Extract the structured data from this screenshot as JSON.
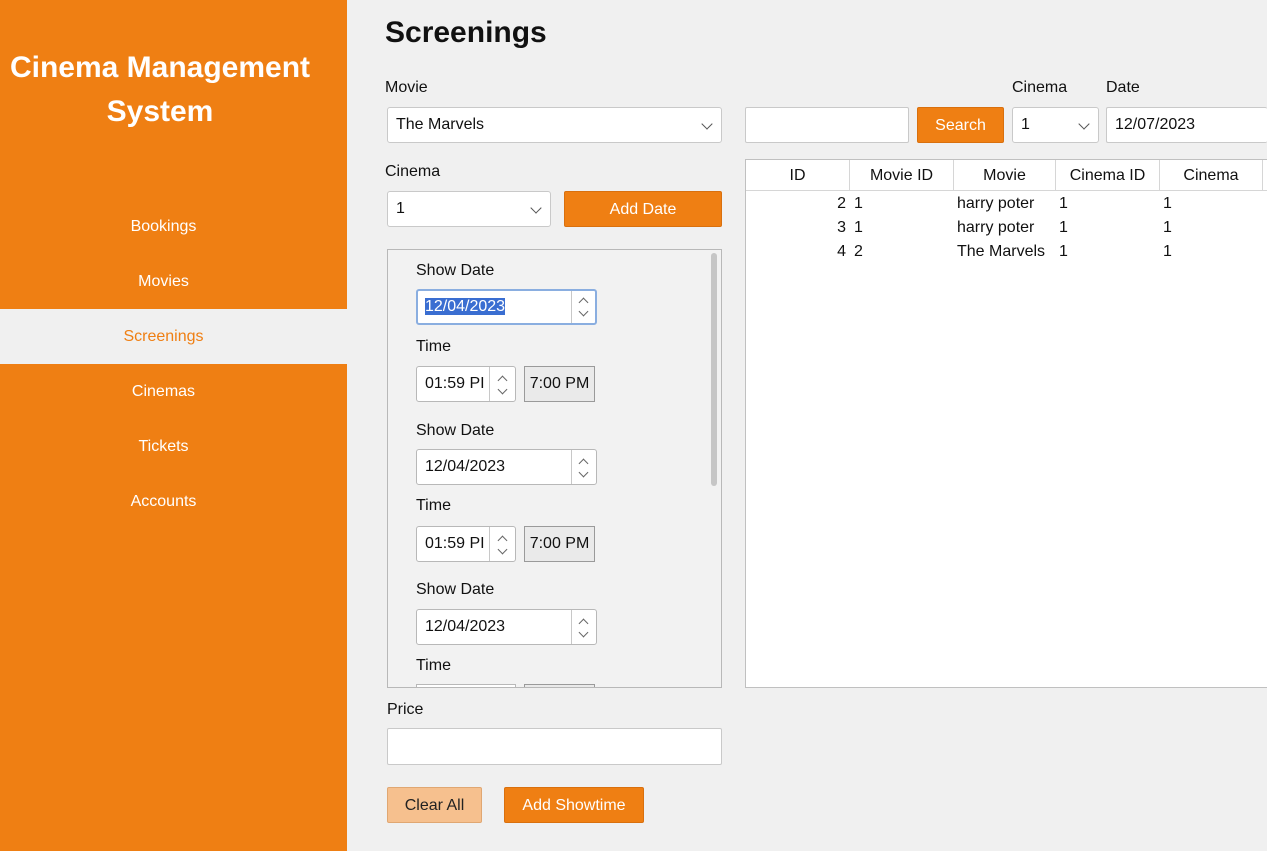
{
  "app": {
    "title_line1": "Cinema Management",
    "title_line2": "System"
  },
  "sidebar": {
    "items": [
      {
        "label": "Bookings"
      },
      {
        "label": "Movies"
      },
      {
        "label": "Screenings",
        "active": true
      },
      {
        "label": "Cinemas"
      },
      {
        "label": "Tickets"
      },
      {
        "label": "Accounts"
      }
    ]
  },
  "page": {
    "title": "Screenings"
  },
  "form": {
    "movie_label": "Movie",
    "movie_value": "The Marvels",
    "cinema_label": "Cinema",
    "cinema_value": "1",
    "add_date_label": "Add Date",
    "showtimes": [
      {
        "date_label": "Show Date",
        "date": "12/04/2023",
        "time_label": "Time",
        "time": "01:59 PI",
        "time_display": "7:00 PM"
      },
      {
        "date_label": "Show Date",
        "date": "12/04/2023",
        "time_label": "Time",
        "time": "01:59 PI",
        "time_display": "7:00 PM"
      },
      {
        "date_label": "Show Date",
        "date": "12/04/2023",
        "time_label": "Time"
      }
    ],
    "price_label": "Price",
    "price_value": "",
    "clear_label": "Clear All",
    "add_showtime_label": "Add Showtime"
  },
  "filter": {
    "search_value": "",
    "search_label": "Search",
    "cinema_label": "Cinema",
    "cinema_value": "1",
    "date_label": "Date",
    "date_value": "12/07/2023"
  },
  "table": {
    "columns": [
      "ID",
      "Movie ID",
      "Movie",
      "Cinema ID",
      "Cinema"
    ],
    "rows": [
      [
        "2",
        "1",
        "harry poter",
        "1",
        "1"
      ],
      [
        "3",
        "1",
        "harry poter",
        "1",
        "1"
      ],
      [
        "4",
        "2",
        "The Marvels",
        "1",
        "1"
      ]
    ]
  },
  "colors": {
    "accent": "#ef7f13",
    "background": "#f0f0f0",
    "selection": "#3a6ed1"
  }
}
